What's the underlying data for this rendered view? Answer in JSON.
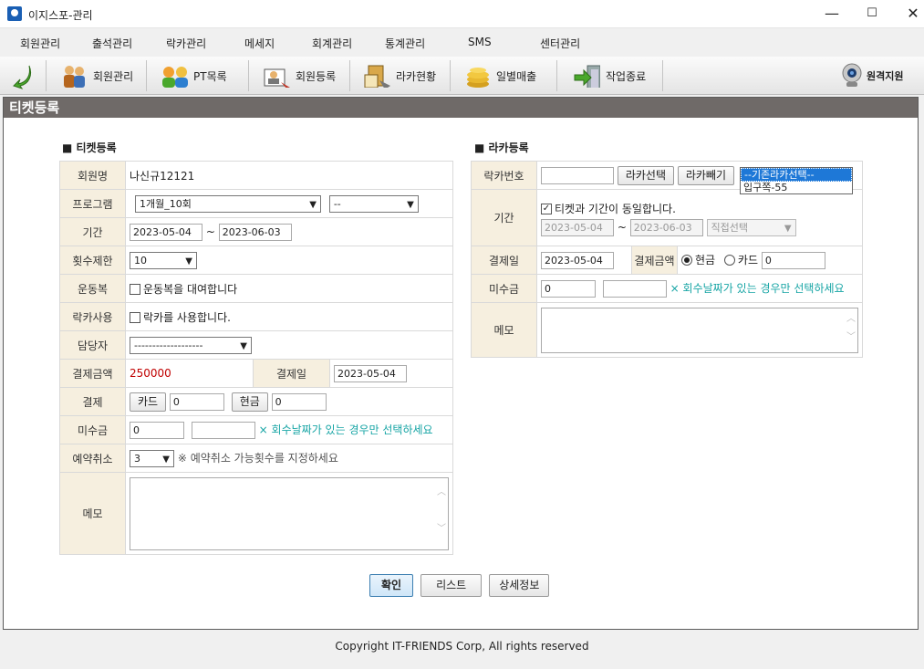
{
  "window": {
    "title": "이지스포-관리",
    "min": "—",
    "max": "☐",
    "close": "✕"
  },
  "menu": [
    "회원관리",
    "출석관리",
    "락카관리",
    "메세지",
    "회계관리",
    "통계관리",
    "SMS",
    "센터관리"
  ],
  "toolbar": {
    "items": [
      {
        "label": "회원관리",
        "icon": "members-icon"
      },
      {
        "label": "PT목록",
        "icon": "pt-list-icon"
      },
      {
        "label": "회원등록",
        "icon": "member-register-icon"
      },
      {
        "label": "라카현황",
        "icon": "locker-status-icon"
      },
      {
        "label": "일별매출",
        "icon": "daily-sales-icon"
      },
      {
        "label": "작업종료",
        "icon": "exit-icon"
      }
    ],
    "remote": "원격지원"
  },
  "page_title": "티켓등록",
  "ticket": {
    "section": "티켓등록",
    "member_label": "회원명",
    "member_value": "나신규12121",
    "program_label": "프로그램",
    "program_value": "1개월_10회",
    "program2_value": "--",
    "period_label": "기간",
    "start": "2023-05-04",
    "tilde": "~",
    "end": "2023-06-03",
    "count_label": "횟수제한",
    "count_value": "10",
    "wear_label": "운동복",
    "wear_text": "운동복을 대여합니다",
    "locker_label": "락카사용",
    "locker_text": "락카를 사용합니다.",
    "staff_label": "담당자",
    "staff_value": "-------------------",
    "amount_label": "결제금액",
    "amount_value": "250000",
    "paydate_label": "결제일",
    "paydate_value": "2023-05-04",
    "pay_label": "결제",
    "card_btn": "카드",
    "card_value": "0",
    "cash_btn": "현금",
    "cash_value": "0",
    "unpaid_label": "미수금",
    "unpaid_value": "0",
    "unpaid_x": "×",
    "unpaid_hint": "회수날짜가 있는 경우만 선택하세요",
    "cancel_label": "예약취소",
    "cancel_value": "3",
    "cancel_hint": "※ 예약취소 가능횟수를 지정하세요",
    "memo_label": "메모"
  },
  "locker": {
    "section": "라카등록",
    "no_label": "락카번호",
    "select_btn": "라카선택",
    "remove_btn": "라카빼기",
    "dropdown_selected": "--기존라카선택--",
    "dropdown_option": "입구쪽-55",
    "period_label": "기간",
    "same_text": "티켓과 기간이 동일합니다.",
    "start": "2023-05-04",
    "tilde": "~",
    "end": "2023-06-03",
    "direct": "직접선택",
    "paydate_label": "결제일",
    "paydate_value": "2023-05-04",
    "amount_label": "결제금액",
    "cash": "현금",
    "card": "카드",
    "amount_value": "0",
    "unpaid_label": "미수금",
    "unpaid_value": "0",
    "unpaid_x": "×",
    "unpaid_hint": "회수날짜가 있는 경우만 선택하세요",
    "memo_label": "메모"
  },
  "actions": {
    "confirm": "확인",
    "list": "리스트",
    "detail": "상세정보"
  },
  "footer": "Copyright IT-FRIENDS Corp, All rights reserved"
}
